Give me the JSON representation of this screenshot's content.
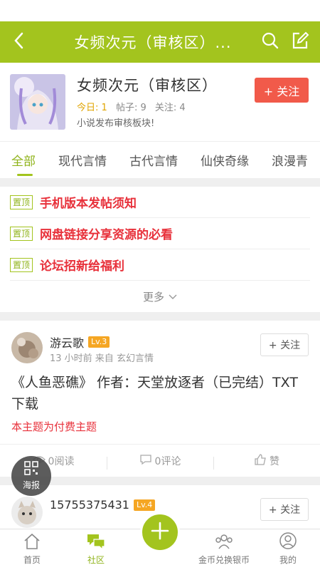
{
  "nav": {
    "title": "女频次元（审核区）...",
    "back_icon": "chevron-left-icon",
    "search_icon": "search-icon",
    "compose_icon": "edit-icon"
  },
  "forum": {
    "name": "女频次元（审核区）",
    "today_label": "今日: 1",
    "posts_label": "帖子: 9",
    "follows_label": "关注: 4",
    "description": "小说发布审核板块!",
    "follow_label": "+ 关注"
  },
  "tabs": [
    "全部",
    "现代言情",
    "古代言情",
    "仙侠奇缘",
    "浪漫青"
  ],
  "pinned": {
    "tag": "置顶",
    "items": [
      "手机版本发帖须知",
      "网盘链接分享资源的必看",
      "论坛招新给福利"
    ],
    "more_label": "更多"
  },
  "posts": [
    {
      "username": "游云歌",
      "level": "Lv.3",
      "meta": "13 小时前  来自 玄幻言情",
      "follow_label": "+ 关注",
      "title": "《人鱼恶礁》 作者：天堂放逐者（已完结）TXT下载",
      "paid_label": "本主题为付费主题",
      "views_label": "0阅读",
      "comments_label": "0评论",
      "like_label": "赞"
    },
    {
      "username": "15755375431",
      "level": "Lv.4",
      "follow_label": "+ 关注"
    }
  ],
  "poster_label": "海报",
  "bottom_nav": [
    {
      "label": "首页",
      "icon": "home-icon"
    },
    {
      "label": "社区",
      "icon": "chat-icon"
    },
    {
      "label": "",
      "icon": "plus-icon"
    },
    {
      "label": "金币兑换银币",
      "icon": "group-icon"
    },
    {
      "label": "我的",
      "icon": "user-icon"
    }
  ],
  "colors": {
    "accent": "#a3c41e",
    "follow_red": "#f15a4a",
    "pinned_red": "#e8313b",
    "level_orange": "#f5a623"
  }
}
